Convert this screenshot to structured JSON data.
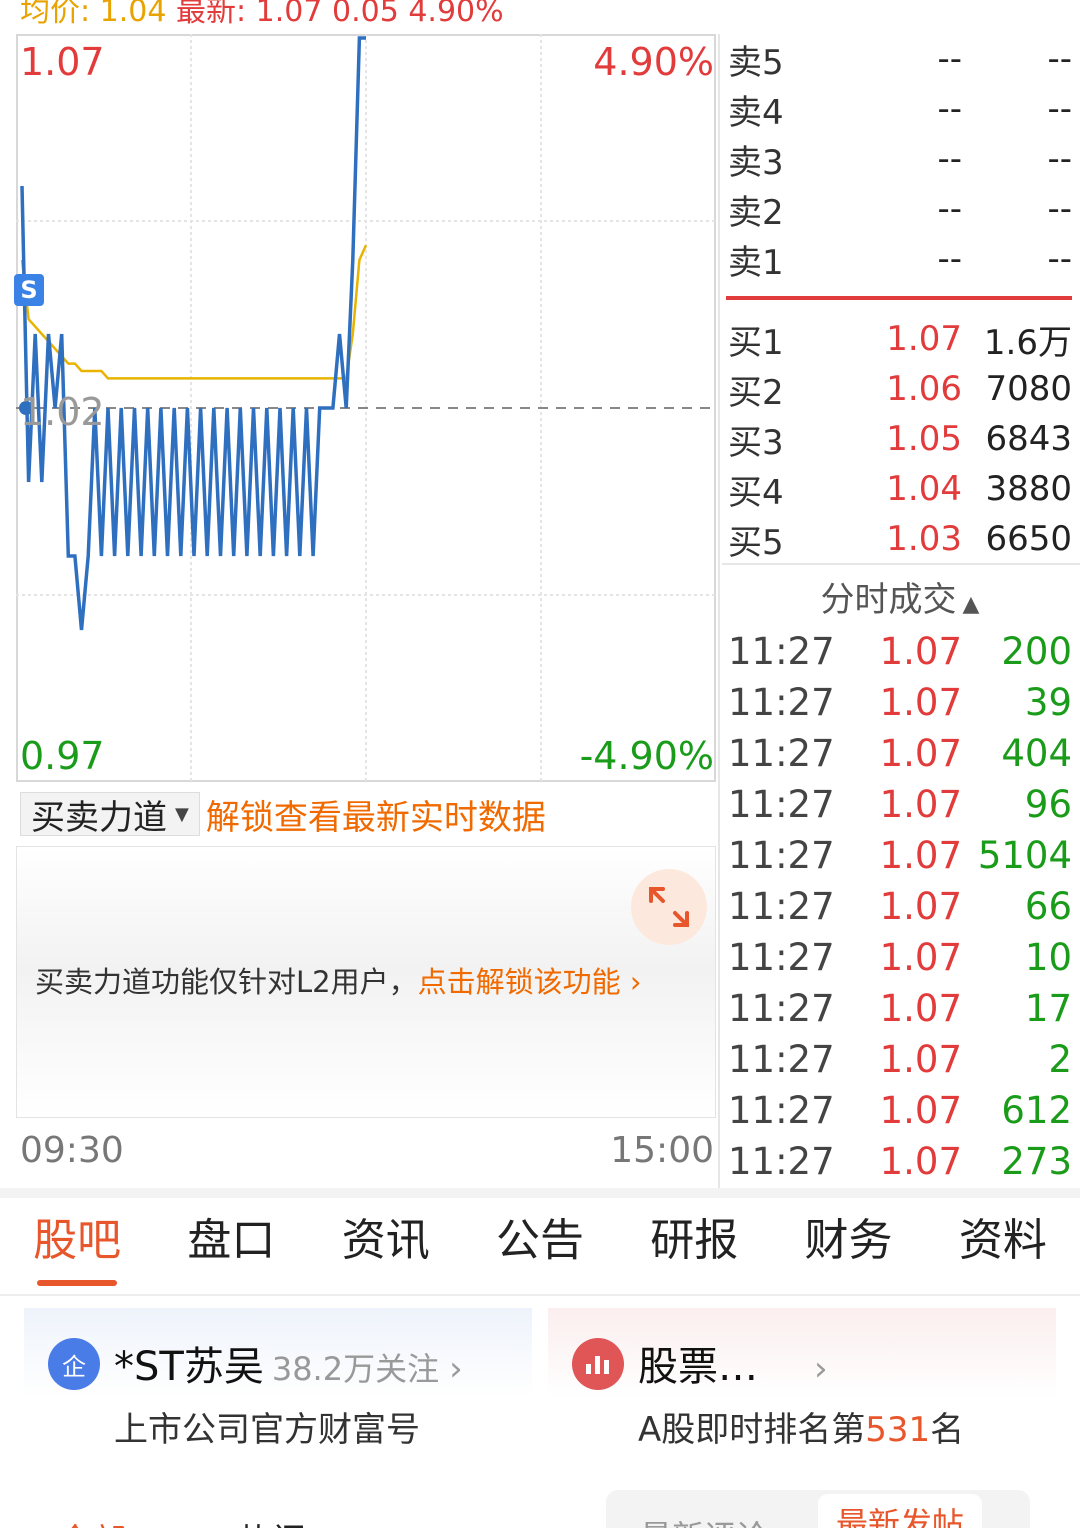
{
  "header": {
    "avg_label": "均价:",
    "avg_value": "1.04",
    "last_label": "最新:",
    "last_value": "1.07",
    "change": "0.05",
    "change_pct": "4.90%"
  },
  "chart": {
    "price_high": "1.07",
    "price_mid": "1.02",
    "price_low": "0.97",
    "pct_high": "4.90%",
    "pct_low": "-4.90%",
    "s_marker": "S",
    "time_start": "09:30",
    "time_end": "15:00"
  },
  "chart_data": {
    "type": "line",
    "y_range": [
      0.97,
      1.07
    ],
    "reference": 1.02,
    "series": [
      {
        "values": [
          1.05,
          1.01,
          1.03,
          1.01,
          1.03,
          1.02,
          1.03,
          1.0,
          1.0,
          0.99,
          1.0,
          1.02,
          1.0,
          1.02,
          1.0,
          1.02,
          1.0,
          1.02,
          1.0,
          1.02,
          1.0,
          1.02,
          1.0,
          1.02,
          1.0,
          1.02,
          1.0,
          1.02,
          1.0,
          1.02,
          1.0,
          1.02,
          1.0,
          1.02,
          1.0,
          1.02,
          1.0,
          1.02,
          1.0,
          1.02,
          1.0,
          1.02,
          1.0,
          1.02,
          1.0,
          1.02,
          1.02,
          1.02,
          1.03,
          1.02,
          1.04,
          1.07,
          1.07
        ]
      },
      {
        "values": [
          1.04,
          1.032,
          1.031,
          1.03,
          1.029,
          1.028,
          1.027,
          1.026,
          1.026,
          1.025,
          1.025,
          1.025,
          1.025,
          1.024,
          1.024,
          1.024,
          1.024,
          1.024,
          1.024,
          1.024,
          1.024,
          1.024,
          1.024,
          1.024,
          1.024,
          1.024,
          1.024,
          1.024,
          1.024,
          1.024,
          1.024,
          1.024,
          1.024,
          1.024,
          1.024,
          1.024,
          1.024,
          1.024,
          1.024,
          1.024,
          1.024,
          1.024,
          1.024,
          1.024,
          1.024,
          1.024,
          1.024,
          1.024,
          1.024,
          1.024,
          1.03,
          1.04,
          1.042
        ]
      }
    ],
    "colors": {
      "price": "#2f6fbf",
      "average": "#e8b400"
    }
  },
  "controls": {
    "indicator": "买卖力道",
    "unlock_text": "解锁查看最新实时数据",
    "l2_message": "买卖力道功能仅针对L2用户，",
    "l2_cta": "点击解锁该功能",
    "l2_cta_chevron": "›"
  },
  "order_book": {
    "sells": [
      {
        "label": "卖5",
        "price": "--",
        "volume": "--"
      },
      {
        "label": "卖4",
        "price": "--",
        "volume": "--"
      },
      {
        "label": "卖3",
        "price": "--",
        "volume": "--"
      },
      {
        "label": "卖2",
        "price": "--",
        "volume": "--"
      },
      {
        "label": "卖1",
        "price": "--",
        "volume": "--"
      }
    ],
    "buys": [
      {
        "label": "买1",
        "price": "1.07",
        "volume": "1.6万"
      },
      {
        "label": "买2",
        "price": "1.06",
        "volume": "7080"
      },
      {
        "label": "买3",
        "price": "1.05",
        "volume": "6843"
      },
      {
        "label": "买4",
        "price": "1.04",
        "volume": "3880"
      },
      {
        "label": "买5",
        "price": "1.03",
        "volume": "6650"
      }
    ]
  },
  "ticks": {
    "title": "分时成交",
    "rows": [
      {
        "time": "11:27",
        "price": "1.07",
        "volume": "200"
      },
      {
        "time": "11:27",
        "price": "1.07",
        "volume": "39"
      },
      {
        "time": "11:27",
        "price": "1.07",
        "volume": "404"
      },
      {
        "time": "11:27",
        "price": "1.07",
        "volume": "96"
      },
      {
        "time": "11:27",
        "price": "1.07",
        "volume": "5104"
      },
      {
        "time": "11:27",
        "price": "1.07",
        "volume": "66"
      },
      {
        "time": "11:27",
        "price": "1.07",
        "volume": "10"
      },
      {
        "time": "11:27",
        "price": "1.07",
        "volume": "17"
      },
      {
        "time": "11:27",
        "price": "1.07",
        "volume": "2"
      },
      {
        "time": "11:27",
        "price": "1.07",
        "volume": "612"
      },
      {
        "time": "11:27",
        "price": "1.07",
        "volume": "273"
      }
    ]
  },
  "tabs": [
    "股吧",
    "盘口",
    "资讯",
    "公告",
    "研报",
    "财务",
    "资料"
  ],
  "cards": {
    "company": {
      "badge": "企",
      "name": "*ST苏吴",
      "followers": "38.2万关注",
      "chevron": "›",
      "subtitle": "上市公司官方财富号"
    },
    "ranking": {
      "name": "股票…",
      "chevron": "›",
      "subtitle_prefix": "A股即时排名第",
      "rank": "531",
      "subtitle_suffix": "名"
    }
  },
  "bottom": {
    "left_tab": "全部",
    "mid_tab": "热门",
    "seg_left": "最新评论",
    "seg_right": "最新发帖"
  }
}
